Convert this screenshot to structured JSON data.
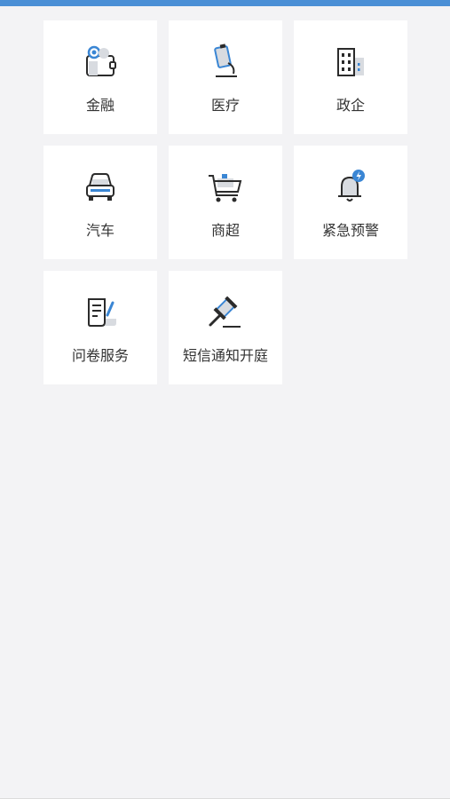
{
  "colors": {
    "top_bar": "#4a8fd6",
    "background": "#f3f3f5",
    "tile": "#ffffff",
    "icon_stroke": "#2b2b2b",
    "icon_accent": "#3a86d4",
    "icon_fill": "#d8dbe0"
  },
  "services": [
    {
      "label": "金融",
      "icon": "wallet-icon"
    },
    {
      "label": "医疗",
      "icon": "medical-device-icon"
    },
    {
      "label": "政企",
      "icon": "building-icon"
    },
    {
      "label": "汽车",
      "icon": "car-icon"
    },
    {
      "label": "商超",
      "icon": "shopping-cart-icon"
    },
    {
      "label": "紧急预警",
      "icon": "alarm-bell-icon"
    },
    {
      "label": "问卷服务",
      "icon": "questionnaire-icon"
    },
    {
      "label": "短信通知开庭",
      "icon": "gavel-icon"
    }
  ]
}
